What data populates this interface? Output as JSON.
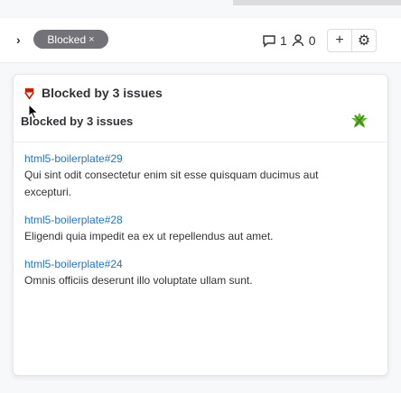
{
  "toolbar": {
    "badge_label": "Blocked",
    "badge_close": "×",
    "comment_count": "1",
    "user_count": "0",
    "add_label": "+",
    "settings_label": "⚙"
  },
  "popover": {
    "title": "Blocked by 3 issues",
    "subtitle": "Blocked by 3 issues",
    "issues": [
      {
        "ref": "html5-boilerplate#29",
        "title": "Qui sint odit consectetur enim sit esse quisquam ducimus aut excepturi."
      },
      {
        "ref": "html5-boilerplate#28",
        "title": "Eligendi quia impedit ea ex ut repellendus aut amet."
      },
      {
        "ref": "html5-boilerplate#24",
        "title": "Omnis officiis deserunt illo voluptate ullam sunt."
      }
    ]
  },
  "colors": {
    "badge": "#737278",
    "link": "#1f75cb",
    "blocked_icon": "#c91c00",
    "avatar": "#6bba2f"
  },
  "icons": [
    "chevron-right-icon",
    "comment-icon",
    "user-icon",
    "plus-icon",
    "gear-icon",
    "issue-blocked-icon",
    "avatar-icon"
  ]
}
